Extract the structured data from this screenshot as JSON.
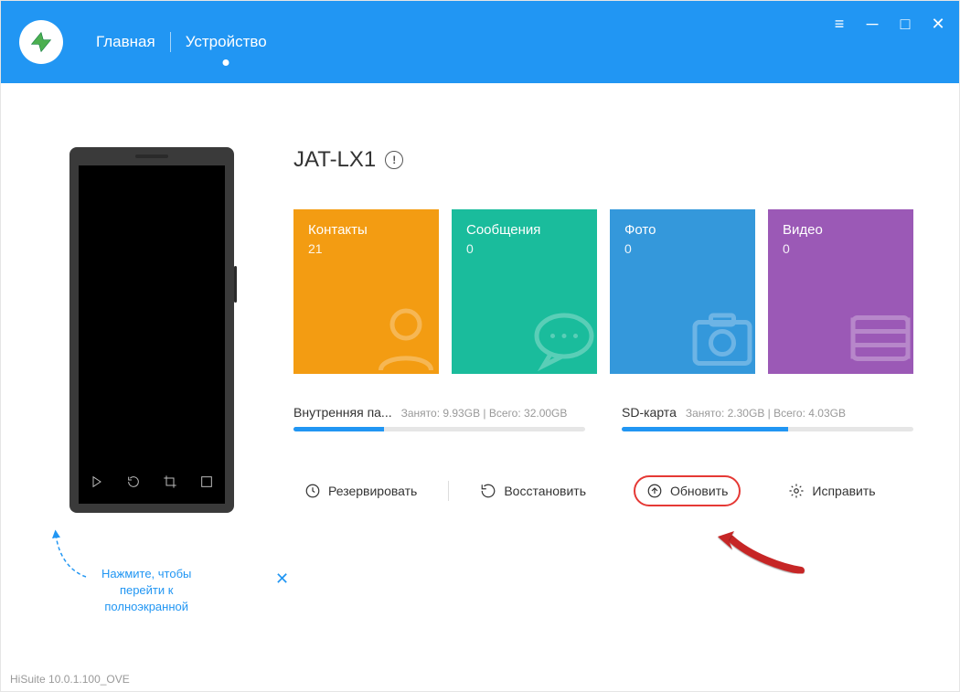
{
  "nav": {
    "home": "Главная",
    "device": "Устройство"
  },
  "device": {
    "name": "JAT-LX1"
  },
  "tiles": {
    "contacts": {
      "label": "Контакты",
      "count": "21"
    },
    "messages": {
      "label": "Сообщения",
      "count": "0"
    },
    "photos": {
      "label": "Фото",
      "count": "0"
    },
    "videos": {
      "label": "Видео",
      "count": "0"
    }
  },
  "storage": {
    "internal": {
      "label": "Внутренняя па...",
      "used_label": "Занято:",
      "used_value": "9.93GB",
      "total_label": "Всего:",
      "total_value": "32.00GB",
      "percent": 31
    },
    "sd": {
      "label": "SD-карта",
      "used_label": "Занято:",
      "used_value": "2.30GB",
      "total_label": "Всего:",
      "total_value": "4.03GB",
      "percent": 57
    }
  },
  "actions": {
    "backup": "Резервировать",
    "restore": "Восстановить",
    "update": "Обновить",
    "repair": "Исправить"
  },
  "tooltip": {
    "line1": "Нажмите, чтобы",
    "line2": "перейти к",
    "line3": "полноэкранной"
  },
  "version": "HiSuite 10.0.1.100_OVE"
}
